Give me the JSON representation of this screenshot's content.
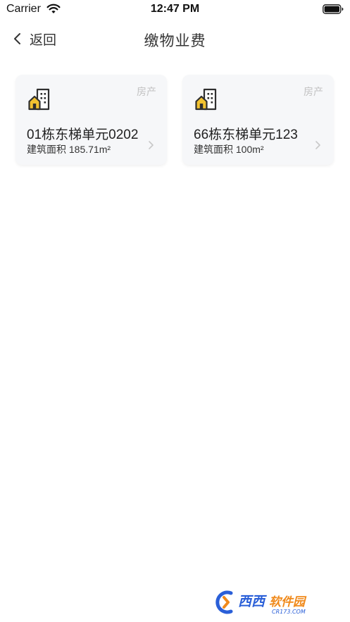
{
  "status_bar": {
    "carrier": "Carrier",
    "time": "12:47 PM",
    "icons": [
      "wifi-icon",
      "battery-icon"
    ]
  },
  "nav": {
    "back_label": "返回",
    "title": "缴物业费",
    "back_icon": "chevron-left-icon"
  },
  "properties": [
    {
      "type": "房产",
      "name": "01栋东梯单元0202",
      "area": "建筑面积 185.71m²",
      "icon": "building-icon"
    },
    {
      "type": "房产",
      "name": "66栋东梯单元123",
      "area": "建筑面积 100m²",
      "icon": "building-icon"
    }
  ],
  "watermark": {
    "text": "西西软件园",
    "subtext": "CR173.COM"
  },
  "colors": {
    "card_bg": "#f6f7f9",
    "icon_yellow": "#f2c230",
    "icon_dark": "#2f2f2f",
    "muted": "#c2c2c2",
    "watermark_blue": "#2a5fd8",
    "watermark_orange": "#f08a1c"
  }
}
